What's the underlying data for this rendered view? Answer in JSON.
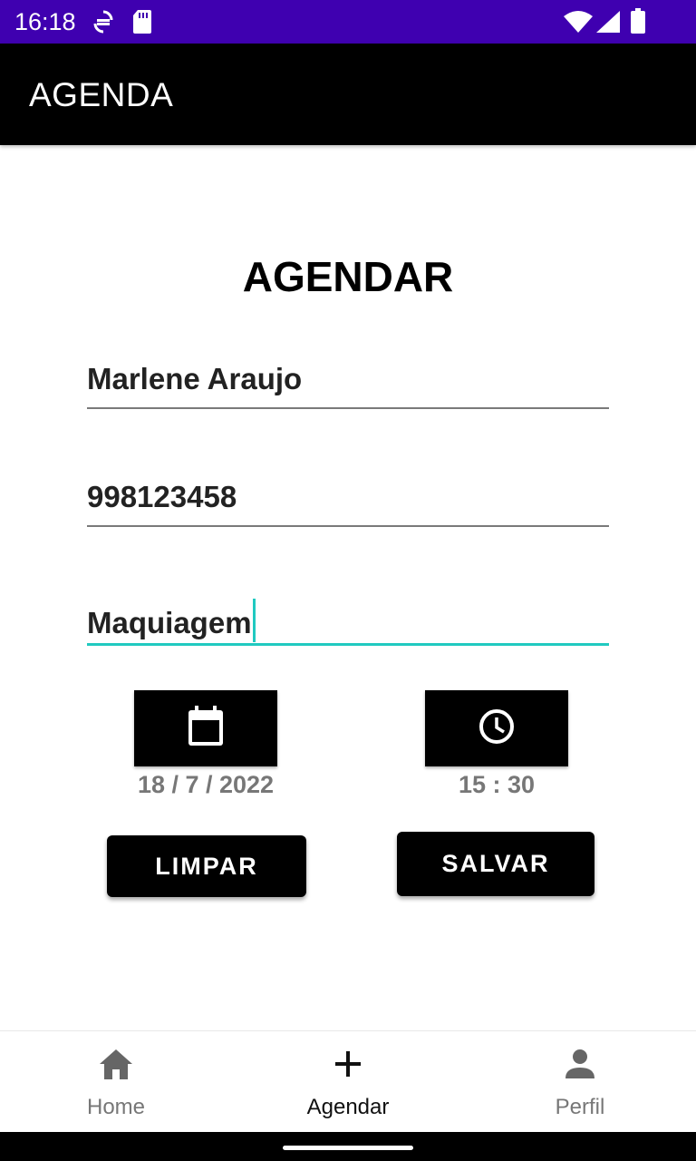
{
  "status_bar": {
    "time": "16:18",
    "background": "#3f00b0",
    "icons": [
      "sync-icon",
      "sd-card-icon",
      "wifi-icon",
      "signal-icon",
      "battery-icon"
    ]
  },
  "app_bar": {
    "title": "AGENDA",
    "background": "#000000"
  },
  "form": {
    "heading": "AGENDAR",
    "name_value": "Marlene Araujo",
    "phone_value": "998123458",
    "service_value": "Maquiagem",
    "accent_color": "#20c9c0",
    "date_button_icon": "calendar-icon",
    "time_button_icon": "clock-icon",
    "date_value": "18 / 7 / 2022",
    "time_value": "15 : 30",
    "clear_label": "LIMPAR",
    "save_label": "SALVAR"
  },
  "bottom_nav": {
    "items": [
      {
        "label": "Home",
        "icon": "home-icon",
        "active": false
      },
      {
        "label": "Agendar",
        "icon": "plus-icon",
        "active": true
      },
      {
        "label": "Perfil",
        "icon": "person-icon",
        "active": false
      }
    ]
  }
}
